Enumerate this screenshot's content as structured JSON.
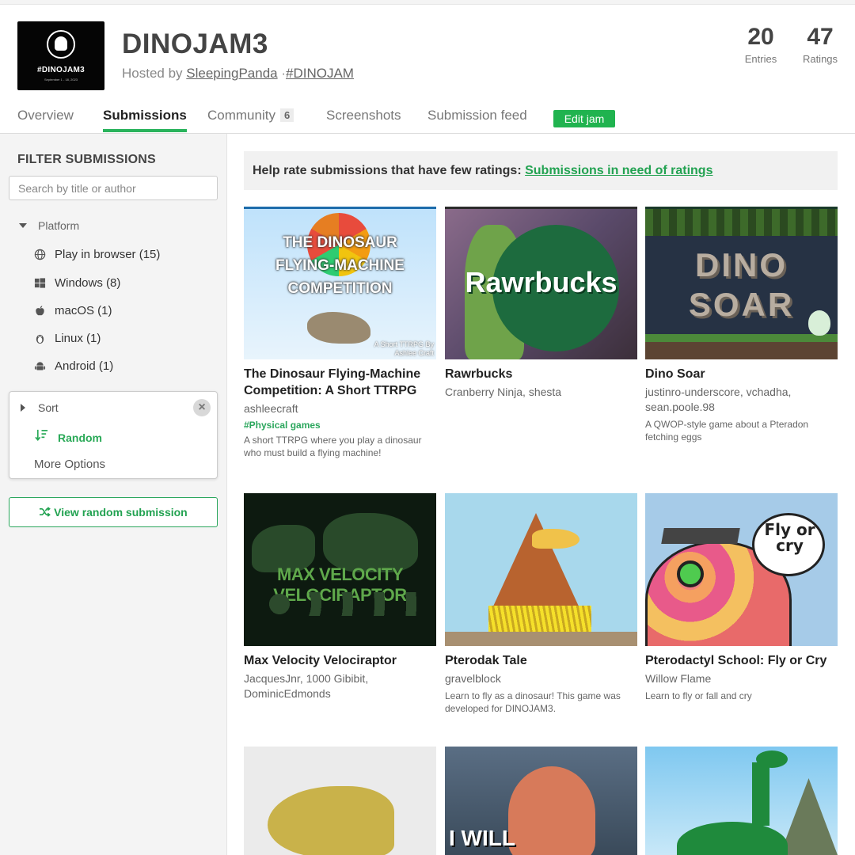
{
  "jam": {
    "title": "DINOJAM3",
    "hosted_prefix": "Hosted by",
    "host": "SleepingPanda",
    "separator": "·",
    "hashtag": "#DINOJAM",
    "logo_text": "#DINOJAM3",
    "logo_dates": "September 1 - 18, 2023"
  },
  "stats": [
    {
      "value": "20",
      "label": "Entries"
    },
    {
      "value": "47",
      "label": "Ratings"
    }
  ],
  "tabs": [
    {
      "label": "Overview"
    },
    {
      "label": "Submissions",
      "active": true
    },
    {
      "label": "Community",
      "count": "6"
    },
    {
      "label": "Screenshots"
    },
    {
      "label": "Submission feed"
    }
  ],
  "edit_label": "Edit jam",
  "sidebar": {
    "title": "FILTER SUBMISSIONS",
    "search_placeholder": "Search by title or author",
    "platform_label": "Platform",
    "platforms": [
      {
        "label": "Play in browser (15)",
        "icon": "globe-icon"
      },
      {
        "label": "Windows (8)",
        "icon": "windows-icon"
      },
      {
        "label": "macOS (1)",
        "icon": "apple-icon"
      },
      {
        "label": "Linux (1)",
        "icon": "linux-icon"
      },
      {
        "label": "Android (1)",
        "icon": "android-icon"
      }
    ],
    "sort_label": "Sort",
    "sort_value": "Random",
    "more_options": "More Options",
    "random_button": "View random submission"
  },
  "banner": {
    "text": "Help rate submissions that have few ratings:",
    "link": "Submissions in need of ratings"
  },
  "games": [
    {
      "title": "The Dinosaur Flying-Machine Competition: A Short TTRPG",
      "author": "ashleecraft",
      "tag": "#Physical games",
      "desc": "A short TTRPG where you play a dinosaur who must build a flying machine!",
      "art": "THE DINOSAUR FLYING-MACHINE COMPETITION",
      "art_sub": "A Short TTRPG By Ashlee Craft"
    },
    {
      "title": "Rawrbucks",
      "author": "Cranberry Ninja, shesta",
      "art": "Rawrbucks"
    },
    {
      "title": "Dino Soar",
      "author": "justinro-underscore, vchadha, sean.poole.98",
      "desc": "A QWOP-style game about a Pteradon fetching eggs",
      "art": "DINO SOAR"
    },
    {
      "title": "Max Velocity Velociraptor",
      "author": "JacquesJnr, 1000 Gibibit, DominicEdmonds",
      "art": "MAX VELOCITY VELOCIRAPTOR"
    },
    {
      "title": "Pterodak Tale",
      "author": "gravelblock",
      "desc": "Learn to fly as a dinosaur! This game was developed for DINOJAM3."
    },
    {
      "title": "Pterodactyl School: Fly or Cry",
      "author": "Willow Flame",
      "desc": "Learn to fly or fall and cry",
      "art": "Fly or cry"
    },
    {
      "title": "",
      "author": ""
    },
    {
      "title": "",
      "author": "",
      "art": "I WILL"
    },
    {
      "title": "",
      "author": ""
    }
  ],
  "colors": {
    "accent": "#29b35c",
    "link": "#22a251"
  }
}
